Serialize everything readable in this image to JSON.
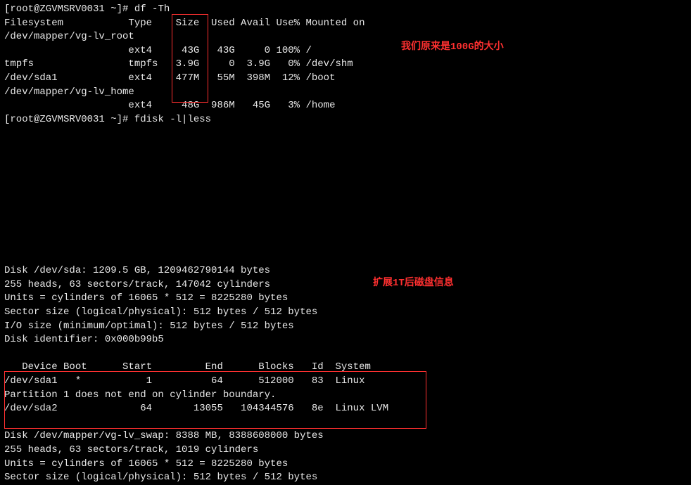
{
  "prompt1": "[root@ZGVMSRV0031 ~]# ",
  "cmd1": "df -Th",
  "df_header": "Filesystem           Type    Size  Used Avail Use% Mounted on",
  "df_row0": "/dev/mapper/vg-lv_root",
  "df_row1": "                     ext4     43G   43G     0 100% /",
  "df_row2": "tmpfs                tmpfs   3.9G     0  3.9G   0% /dev/shm",
  "df_row3": "/dev/sda1            ext4    477M   55M  398M  12% /boot",
  "df_row4": "/dev/mapper/vg-lv_home",
  "df_row5": "                     ext4     48G  986M   45G   3% /home",
  "prompt2": "[root@ZGVMSRV0031 ~]# ",
  "cmd2": "fdisk -l|less",
  "annotation1": "我们原来是100G的大小",
  "annotation2": "扩展1T后磁盘信息",
  "fdisk_l1": "Disk /dev/sda: 1209.5 GB, 1209462790144 bytes",
  "fdisk_l2": "255 heads, 63 sectors/track, 147042 cylinders",
  "fdisk_l3": "Units = cylinders of 16065 * 512 = 8225280 bytes",
  "fdisk_l4": "Sector size (logical/physical): 512 bytes / 512 bytes",
  "fdisk_l5": "I/O size (minimum/optimal): 512 bytes / 512 bytes",
  "fdisk_l6": "Disk identifier: 0x000b99b5",
  "part_header": "   Device Boot      Start         End      Blocks   Id  System",
  "part_row1": "/dev/sda1   *           1          64      512000   83  Linux",
  "part_note": "Partition 1 does not end on cylinder boundary.",
  "part_row2": "/dev/sda2              64       13055   104344576   8e  Linux LVM",
  "swap_l1": "Disk /dev/mapper/vg-lv_swap: 8388 MB, 8388608000 bytes",
  "swap_l2": "255 heads, 63 sectors/track, 1019 cylinders",
  "swap_l3": "Units = cylinders of 16065 * 512 = 8225280 bytes",
  "swap_l4": "Sector size (logical/physical): 512 bytes / 512 bytes",
  "chart_data": {
    "type": "table",
    "df": {
      "columns": [
        "Filesystem",
        "Type",
        "Size",
        "Used",
        "Avail",
        "Use%",
        "Mounted on"
      ],
      "rows": [
        [
          "/dev/mapper/vg-lv_root",
          "ext4",
          "43G",
          "43G",
          "0",
          "100%",
          "/"
        ],
        [
          "tmpfs",
          "tmpfs",
          "3.9G",
          "0",
          "3.9G",
          "0%",
          "/dev/shm"
        ],
        [
          "/dev/sda1",
          "ext4",
          "477M",
          "55M",
          "398M",
          "12%",
          "/boot"
        ],
        [
          "/dev/mapper/vg-lv_home",
          "ext4",
          "48G",
          "986M",
          "45G",
          "3%",
          "/home"
        ]
      ]
    },
    "fdisk_partitions": {
      "columns": [
        "Device",
        "Boot",
        "Start",
        "End",
        "Blocks",
        "Id",
        "System"
      ],
      "rows": [
        [
          "/dev/sda1",
          "*",
          "1",
          "64",
          "512000",
          "83",
          "Linux"
        ],
        [
          "/dev/sda2",
          "",
          "64",
          "13055",
          "104344576",
          "8e",
          "Linux LVM"
        ]
      ],
      "note": "Partition 1 does not end on cylinder boundary."
    }
  }
}
